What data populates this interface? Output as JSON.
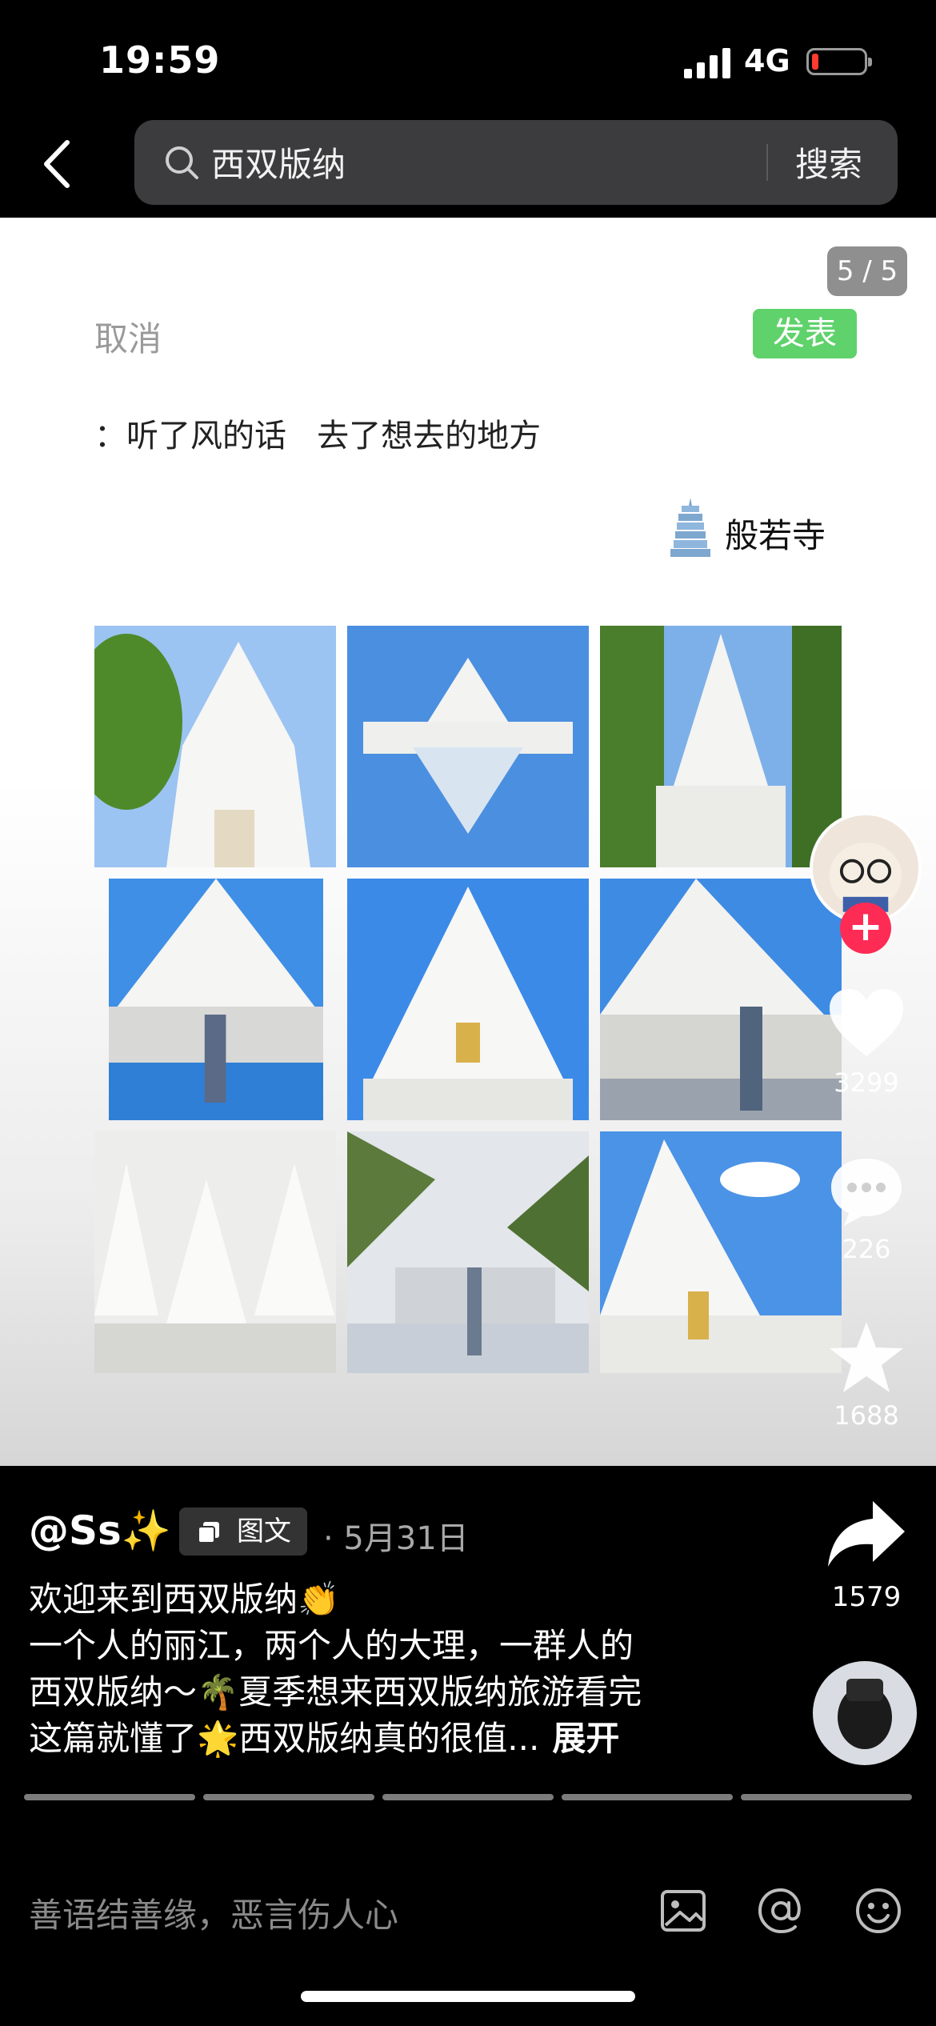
{
  "status_bar": {
    "time": "19:59",
    "network": "4G",
    "battery_color": "#ff3b30"
  },
  "search": {
    "query": "西双版纳",
    "button": "搜索"
  },
  "post": {
    "page_indicator": "5 / 5",
    "cancel": "取消",
    "publish": "发表",
    "text": "：听了风的话   去了想去的地方",
    "location": "般若寺",
    "photos": 9
  },
  "actions": {
    "likes": "3299",
    "comments": "226",
    "favorites": "1688",
    "shares": "1579"
  },
  "author": {
    "handle": "@Ss✨",
    "post_type": "图文",
    "date": "· 5月31日"
  },
  "description": {
    "line1": "欢迎来到西双版纳👏",
    "line2": "一个人的丽江，两个人的大理，一群人的",
    "line3": "西双版纳～🌴夏季想来西双版纳旅游看完",
    "line4": "这篇就懂了🌟西双版纳真的很值...",
    "expand": "展开"
  },
  "comment": {
    "placeholder": "善语结善缘，恶言伤人心"
  },
  "colors": {
    "accent_follow": "#fe2c55",
    "publish_green": "#5fd26b",
    "sky": "#3f8fe6"
  },
  "icons": [
    "back-icon",
    "search-icon",
    "pagoda-icon",
    "heart-icon",
    "comment-icon",
    "star-icon",
    "share-icon",
    "image-icon",
    "at-icon",
    "emoji-icon"
  ]
}
